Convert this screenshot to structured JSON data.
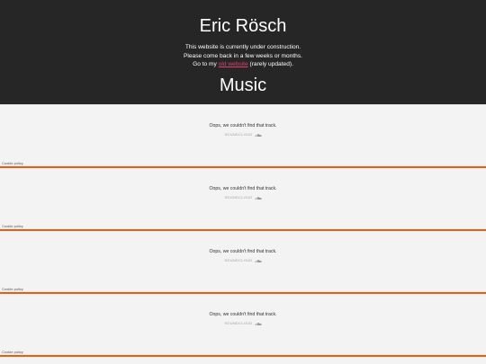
{
  "header": {
    "title": "Eric Rösch",
    "line1": "This website is currently under construction.",
    "line2": "Please come back in a few weeks or months.",
    "line3_before": "Go to my ",
    "line3_link": "old website",
    "line3_after": " (rarely updated).",
    "section_title": "Music"
  },
  "embeds": [
    {
      "message": "Oops, we couldn't find that track.",
      "brand": "SOUNDCLOUD",
      "cookie": "Cookie policy"
    },
    {
      "message": "Oops, we couldn't find that track.",
      "brand": "SOUNDCLOUD",
      "cookie": "Cookie policy"
    },
    {
      "message": "Oops, we couldn't find that track.",
      "brand": "SOUNDCLOUD",
      "cookie": "Cookie policy"
    },
    {
      "message": "Oops, we couldn't find that track.",
      "brand": "SOUNDCLOUD",
      "cookie": "Cookie policy"
    }
  ],
  "colors": {
    "header_bg": "#262626",
    "link": "#e0406f",
    "embed_border": "#f15a0a"
  },
  "icons": {
    "brand_icon": "soundcloud-cloud-icon"
  }
}
